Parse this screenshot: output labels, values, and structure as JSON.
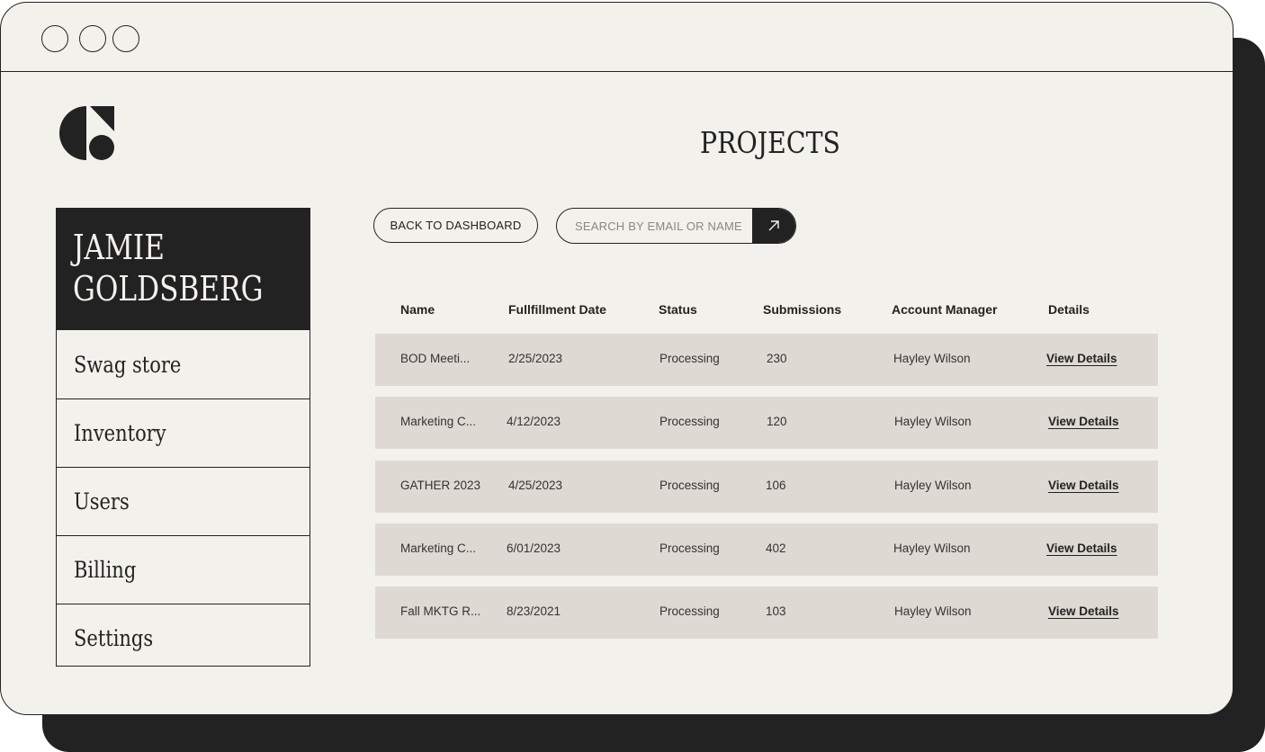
{
  "window": {
    "controls": [
      "window-dot-1",
      "window-dot-2",
      "window-dot-3"
    ]
  },
  "logo": {
    "icon": "brand-logo-icon"
  },
  "page_title": "PROJECTS",
  "sidebar": {
    "user_first": "JAMIE",
    "user_last": "GOLDSBERG",
    "items": [
      {
        "label": "Swag store"
      },
      {
        "label": "Inventory"
      },
      {
        "label": "Users"
      },
      {
        "label": "Billing"
      },
      {
        "label": "Settings"
      }
    ]
  },
  "toolbar": {
    "back_label": "BACK TO DASHBOARD",
    "search_placeholder": "SEARCH BY EMAIL OR NAME",
    "search_value": "",
    "search_icon": "arrow-up-right-icon"
  },
  "table": {
    "headers": [
      "Name",
      "Fullfillment Date",
      "Status",
      "Submissions",
      "Account Manager",
      "Details"
    ],
    "rows": [
      {
        "name": "BOD Meeti...",
        "date": "2/25/2023",
        "status": "Processing",
        "submissions": "230",
        "manager": "Hayley Wilson",
        "details": "View Details"
      },
      {
        "name": "Marketing C...",
        "date": "4/12/2023",
        "status": "Processing",
        "submissions": "120",
        "manager": "Hayley Wilson",
        "details": "View Details"
      },
      {
        "name": "GATHER 2023",
        "date": "4/25/2023",
        "status": "Processing",
        "submissions": "106",
        "manager": "Hayley Wilson",
        "details": "View Details"
      },
      {
        "name": "Marketing C...",
        "date": "6/01/2023",
        "status": "Processing",
        "submissions": "402",
        "manager": "Hayley Wilson",
        "details": "View Details"
      },
      {
        "name": "Fall MKTG R...",
        "date": "8/23/2021",
        "status": "Processing",
        "submissions": "103",
        "manager": "Hayley Wilson",
        "details": "View Details"
      }
    ]
  },
  "colors": {
    "background": "#f3f1ec",
    "ink": "#222222",
    "row_fill": "#dedad3"
  }
}
